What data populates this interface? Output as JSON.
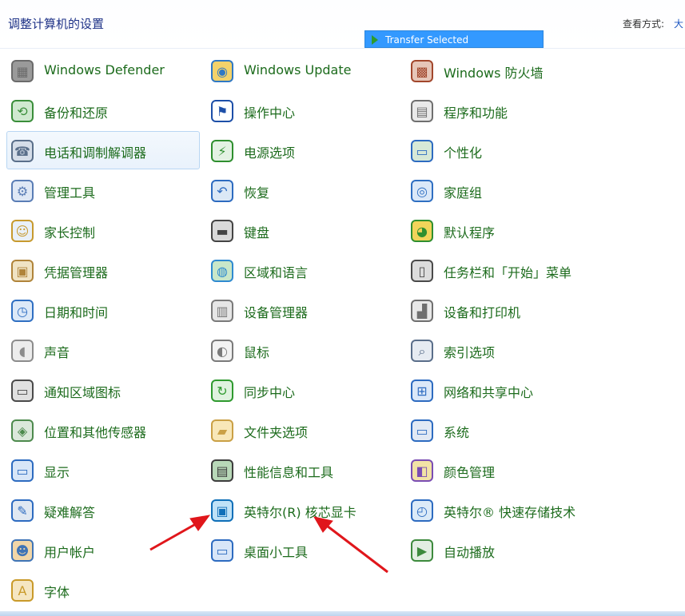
{
  "header": {
    "title": "调整计算机的设置",
    "view_label": "查看方式:",
    "view_value": "大"
  },
  "tooltip": {
    "text": "Transfer Selected"
  },
  "columns": [
    [
      {
        "label": "Windows Defender",
        "icon": "defender-icon"
      },
      {
        "label": "备份和还原",
        "icon": "backup-icon"
      },
      {
        "label": "电话和调制解调器",
        "icon": "phone-modem-icon",
        "highlight": true
      },
      {
        "label": "管理工具",
        "icon": "admin-tools-icon"
      },
      {
        "label": "家长控制",
        "icon": "parental-controls-icon"
      },
      {
        "label": "凭据管理器",
        "icon": "credential-manager-icon"
      },
      {
        "label": "日期和时间",
        "icon": "date-time-icon"
      },
      {
        "label": "声音",
        "icon": "sound-icon"
      },
      {
        "label": "通知区域图标",
        "icon": "notification-area-icon"
      },
      {
        "label": "位置和其他传感器",
        "icon": "location-sensors-icon"
      },
      {
        "label": "显示",
        "icon": "display-icon"
      },
      {
        "label": "疑难解答",
        "icon": "troubleshooting-icon"
      },
      {
        "label": "用户帐户",
        "icon": "user-accounts-icon"
      },
      {
        "label": "字体",
        "icon": "fonts-icon"
      }
    ],
    [
      {
        "label": "Windows Update",
        "icon": "windows-update-icon"
      },
      {
        "label": "操作中心",
        "icon": "action-center-icon"
      },
      {
        "label": "电源选项",
        "icon": "power-options-icon"
      },
      {
        "label": "恢复",
        "icon": "recovery-icon"
      },
      {
        "label": "键盘",
        "icon": "keyboard-icon"
      },
      {
        "label": "区域和语言",
        "icon": "region-language-icon"
      },
      {
        "label": "设备管理器",
        "icon": "device-manager-icon"
      },
      {
        "label": "鼠标",
        "icon": "mouse-icon"
      },
      {
        "label": "同步中心",
        "icon": "sync-center-icon"
      },
      {
        "label": "文件夹选项",
        "icon": "folder-options-icon"
      },
      {
        "label": "性能信息和工具",
        "icon": "performance-icon"
      },
      {
        "label": "英特尔(R) 核芯显卡",
        "icon": "intel-graphics-icon"
      },
      {
        "label": "桌面小工具",
        "icon": "desktop-gadgets-icon"
      }
    ],
    [
      {
        "label": "Windows 防火墙",
        "icon": "firewall-icon"
      },
      {
        "label": "程序和功能",
        "icon": "programs-features-icon"
      },
      {
        "label": "个性化",
        "icon": "personalization-icon"
      },
      {
        "label": "家庭组",
        "icon": "homegroup-icon"
      },
      {
        "label": "默认程序",
        "icon": "default-programs-icon"
      },
      {
        "label": "任务栏和「开始」菜单",
        "icon": "taskbar-start-icon"
      },
      {
        "label": "设备和打印机",
        "icon": "devices-printers-icon"
      },
      {
        "label": "索引选项",
        "icon": "indexing-options-icon"
      },
      {
        "label": "网络和共享中心",
        "icon": "network-sharing-icon"
      },
      {
        "label": "系统",
        "icon": "system-icon"
      },
      {
        "label": "颜色管理",
        "icon": "color-management-icon"
      },
      {
        "label": "英特尔® 快速存储技术",
        "icon": "intel-rst-icon"
      },
      {
        "label": "自动播放",
        "icon": "autoplay-icon"
      }
    ]
  ],
  "colors": {
    "label": "#1c6b1c",
    "title": "#1e3287",
    "tooltip": "#3399ff",
    "arrow": "#e0161b"
  }
}
